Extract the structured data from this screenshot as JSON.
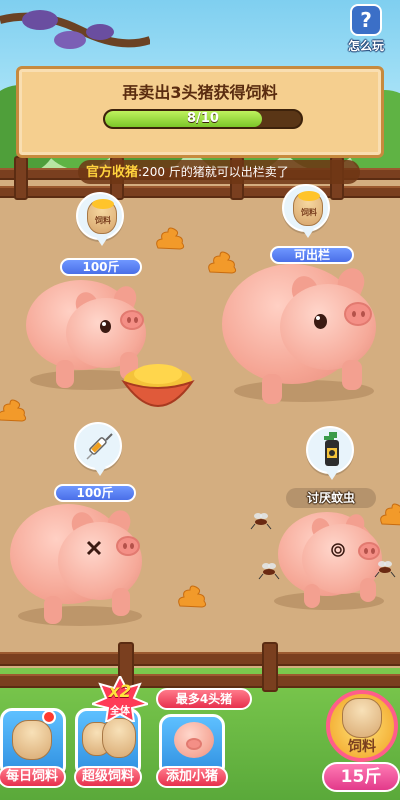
{
  "banner": {
    "title": "再卖出3头猪获得饲料",
    "progress_text": "8/10",
    "progress_fraction": 0.8
  },
  "help": {
    "icon": "question-icon",
    "symbol": "?",
    "label": "怎么玩"
  },
  "notice": {
    "highlight": "官方收猪",
    "text": ":200 斤的猪就可以出栏卖了"
  },
  "pigs": [
    {
      "id": "pig-1",
      "tag": "100斤",
      "bubble": "feed",
      "bubble_label": "饲料"
    },
    {
      "id": "pig-2",
      "tag": "可出栏",
      "bubble": "feed",
      "bubble_label": "饲料"
    },
    {
      "id": "pig-3",
      "tag": "100斤",
      "bubble": "syringe"
    },
    {
      "id": "pig-4",
      "tag": "讨厌蚊虫",
      "bubble": "insect-spray"
    }
  ],
  "bottom_bar": {
    "daily_feed": "每日饲料",
    "super_feed": "超级饲料",
    "x2_badge": "x2",
    "x2_sub": "全体",
    "add_pig": "添加小猪",
    "max_pigs_hint": "最多4头猪",
    "feed_label": "饲料",
    "feed_amount": "15斤"
  },
  "colors": {
    "fence": "#7a3f1f",
    "ground": "#d4ae80",
    "accent_blue": "#4a6fe8",
    "accent_red": "#e7304d",
    "progress": "#7cc629"
  }
}
